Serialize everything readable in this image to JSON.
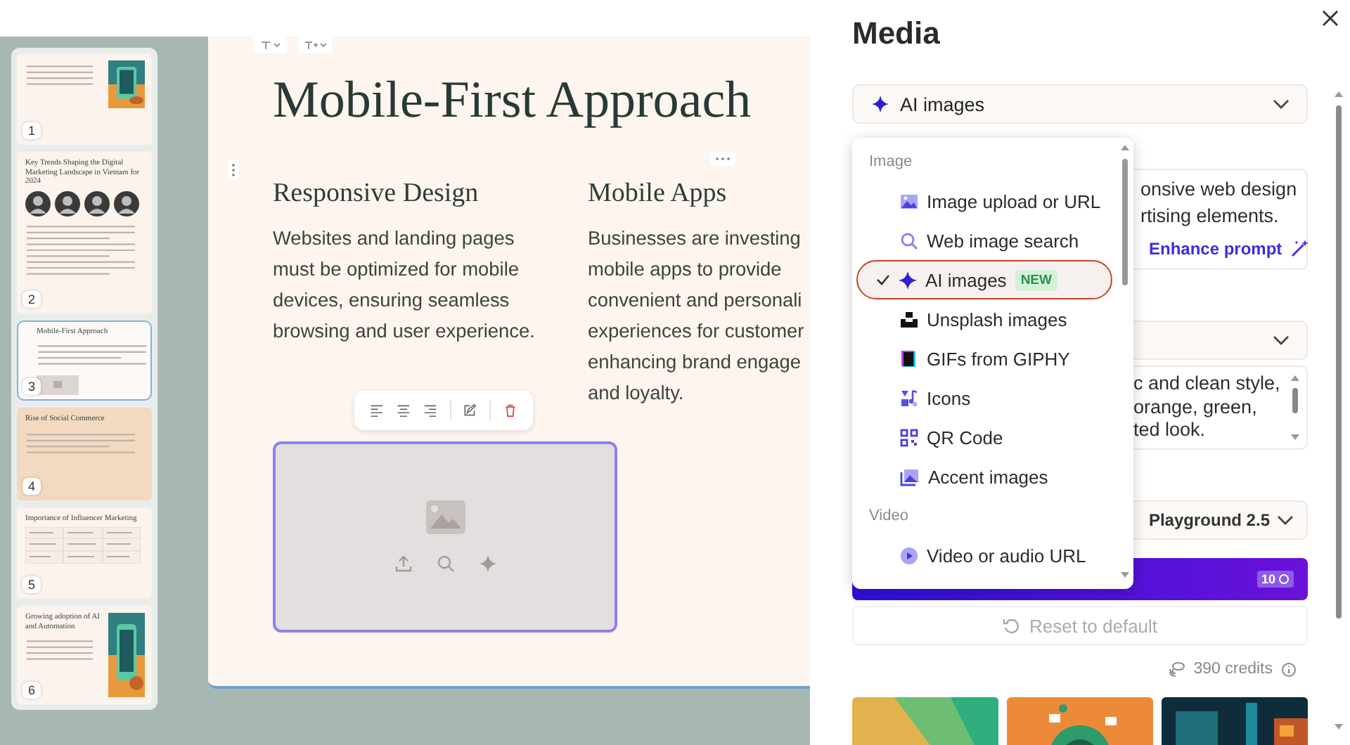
{
  "slides": [
    {
      "number": "1",
      "kind": "image-right",
      "selected": false
    },
    {
      "number": "2",
      "title": "Key Trends Shaping the Digital Marketing Landscape in Vietnam for 2024",
      "kind": "portraits",
      "selected": false
    },
    {
      "number": "3",
      "title": "Mobile-First Approach",
      "kind": "columns",
      "selected": true
    },
    {
      "number": "4",
      "title": "Rise of Social Commerce",
      "kind": "backdrop",
      "selected": false
    },
    {
      "number": "5",
      "title": "Importance of Influencer Marketing",
      "kind": "table",
      "selected": false
    },
    {
      "number": "6",
      "title": "Growing adoption of AI and Automation",
      "kind": "image-right",
      "selected": false
    }
  ],
  "slide": {
    "title": "Mobile-First Approach",
    "columns": [
      {
        "heading": "Responsive Design",
        "lines": [
          "Websites and landing pages",
          "must be optimized for mobile",
          "devices, ensuring seamless",
          "browsing and user experience."
        ]
      },
      {
        "heading": "Mobile Apps",
        "lines": [
          "Businesses are investing",
          "mobile apps to provide",
          "convenient and personali",
          "experiences for customer",
          "enhancing brand engage",
          "and loyalty."
        ]
      }
    ],
    "image_block": {
      "selected": true
    }
  },
  "media": {
    "title": "Media",
    "source": {
      "label": "AI images"
    },
    "prompt": {
      "lines": [
        "onsive web design",
        "rtising elements."
      ],
      "enhance": "Enhance prompt"
    },
    "style_text": {
      "lines": [
        "c and clean style,",
        "orange, green,",
        "ted look."
      ]
    },
    "model": {
      "value": "Playground 2.5"
    },
    "generate": {
      "cost": "10"
    },
    "reset": "Reset to default",
    "credits": "390 credits",
    "dropdown": {
      "groups": [
        {
          "label": "Image",
          "items": [
            {
              "label": "Image upload or URL",
              "selected": false
            },
            {
              "label": "Web image search",
              "selected": false
            },
            {
              "label": "AI images",
              "badge": "NEW",
              "selected": true
            },
            {
              "label": "Unsplash images",
              "selected": false
            },
            {
              "label": "GIFs from GIPHY",
              "selected": false
            },
            {
              "label": "Icons",
              "selected": false
            },
            {
              "label": "QR Code",
              "selected": false
            },
            {
              "label": "Accent images",
              "selected": false
            }
          ]
        },
        {
          "label": "Video",
          "items": [
            {
              "label": "Video or audio URL",
              "selected": false
            }
          ]
        }
      ]
    }
  }
}
